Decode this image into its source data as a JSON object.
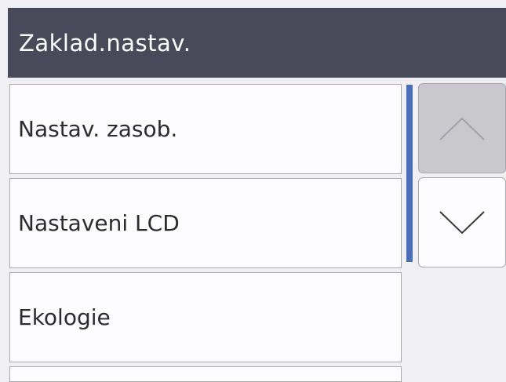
{
  "header": {
    "title": "Zaklad.nastav."
  },
  "menu": {
    "items": [
      {
        "label": "Nastav. zasob."
      },
      {
        "label": "Nastaveni LCD"
      },
      {
        "label": "Ekologie"
      },
      {
        "label": ""
      }
    ]
  },
  "scroll": {
    "up_enabled": false,
    "down_enabled": true,
    "up_icon": "chevron-up-icon",
    "down_icon": "chevron-down-icon"
  },
  "colors": {
    "header_bg": "#484a5a",
    "header_text": "#ffffff",
    "item_bg": "#fdfcff",
    "scroll_indicator": "#4a6fb8",
    "disabled_button": "#c9c8cd"
  }
}
